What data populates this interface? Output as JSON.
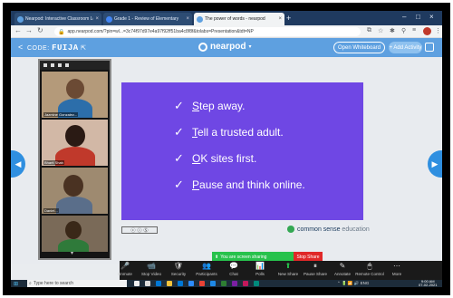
{
  "browser": {
    "tabs": [
      {
        "title": "Nearpod: Interactive Classroom Lessons",
        "color": "#5ea0e0",
        "active": false
      },
      {
        "title": "Grade 1 - Review of Elementary",
        "color": "#4285f4",
        "active": false
      },
      {
        "title": "The power of words - nearpod",
        "color": "#5ea0e0",
        "active": true
      }
    ],
    "new_tab": "+",
    "window_controls": [
      "–",
      "□",
      "×"
    ],
    "url": "app.nearpod.com/?pin=wl...=3c74f97d97e4a97f92ff51ba4c8f8f&tolabs=Presentation&tdt=NP",
    "profile_color": "#c0392b"
  },
  "nearpod": {
    "code_label": "CODE:",
    "code": "FUIJA",
    "back": "<",
    "logo": "nearpod",
    "open_whiteboard": "Open Whiteboard",
    "add_activity": "+ Add Activity"
  },
  "slide": {
    "bg": "#6f47e4",
    "bullets": [
      {
        "first": "S",
        "rest": "tep away."
      },
      {
        "first": "T",
        "rest": "ell a trusted adult."
      },
      {
        "first": "O",
        "rest": "K sites first."
      },
      {
        "first": "P",
        "rest": "ause and think online."
      }
    ],
    "check": "✓",
    "brand": "common sense",
    "brand_suffix": "education"
  },
  "gallery": {
    "participants": [
      {
        "name": "Jazmine Gonzalez..."
      },
      {
        "name": "Bharti Shah"
      },
      {
        "name": "Daniel..."
      },
      {
        "name": ""
      }
    ]
  },
  "sharing": {
    "text": "You are screen sharing",
    "stop": "Stop Share"
  },
  "zoom_toolbar": {
    "items": [
      {
        "icon": "🎤",
        "label": "Unmute"
      },
      {
        "icon": "📹",
        "label": "Stop Video"
      },
      {
        "icon": "🛡",
        "label": "Security"
      },
      {
        "icon": "👥",
        "label": "Participants"
      },
      {
        "icon": "💬",
        "label": "Chat"
      },
      {
        "icon": "📊",
        "label": "Polls"
      },
      {
        "icon": "⬆",
        "label": "New Share"
      },
      {
        "icon": "⏸",
        "label": "Pause Share"
      },
      {
        "icon": "✎",
        "label": "Annotate"
      },
      {
        "icon": "🖱",
        "label": "Remote Control"
      },
      {
        "icon": "⋯",
        "label": "More"
      }
    ]
  },
  "taskbar": {
    "search_placeholder": "Type here to search",
    "time": "9:00 AM",
    "date": "07-02-2021"
  }
}
